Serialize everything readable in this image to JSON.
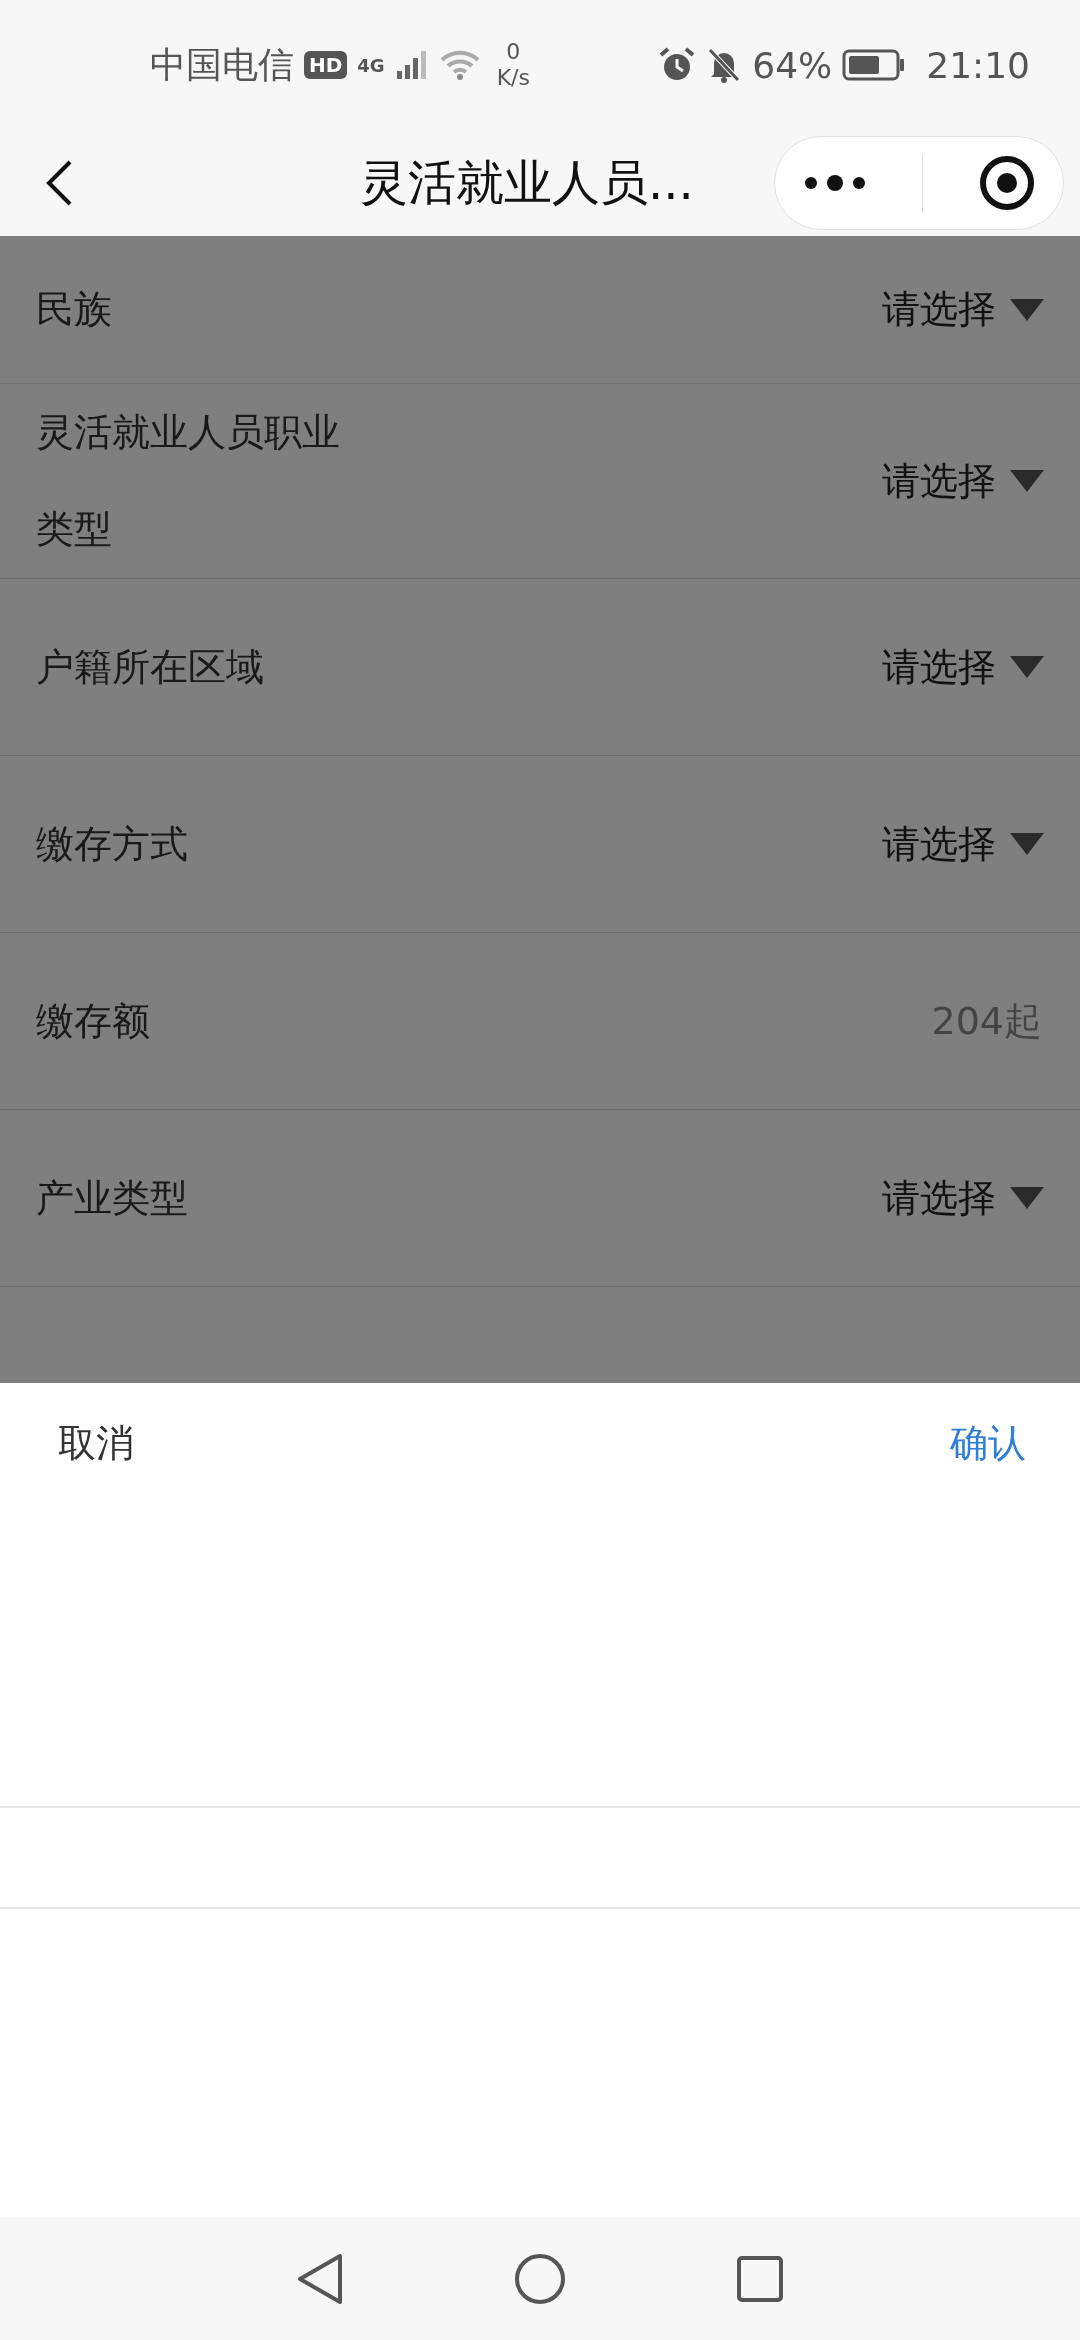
{
  "status_bar": {
    "carrier": "中国电信",
    "hd_badge": "HD",
    "network": "4G",
    "speed_value": "0",
    "speed_unit": "K/s",
    "battery_percent": "64%",
    "time": "21:10"
  },
  "header": {
    "title": "灵活就业人员..."
  },
  "form": {
    "rows": [
      {
        "label": "民族",
        "kind": "select",
        "value": "请选择"
      },
      {
        "label": "灵活就业人员职业类型",
        "kind": "select",
        "value": "请选择"
      },
      {
        "label": "户籍所在区域",
        "kind": "select",
        "value": "请选择"
      },
      {
        "label": "缴存方式",
        "kind": "select",
        "value": "请选择"
      },
      {
        "label": "缴存额",
        "kind": "input",
        "placeholder": "204起"
      },
      {
        "label": "产业类型",
        "kind": "select",
        "value": "请选择"
      }
    ]
  },
  "picker_sheet": {
    "cancel": "取消",
    "confirm": "确认"
  }
}
